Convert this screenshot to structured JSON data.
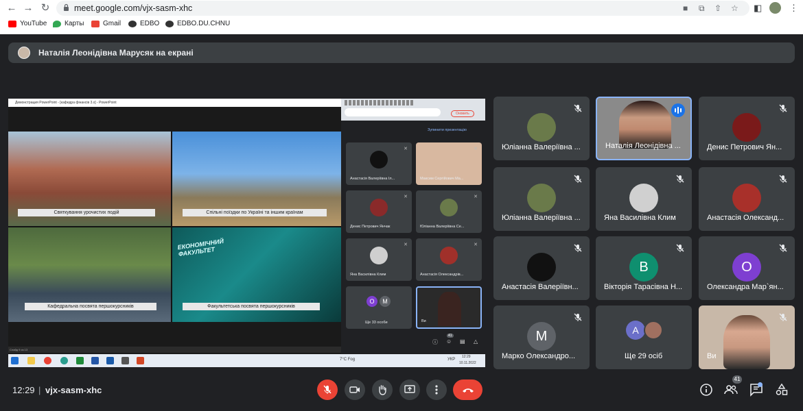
{
  "browser": {
    "url": "meet.google.com/vjx-sasm-xhc",
    "bookmarks": [
      "YouTube",
      "Карты",
      "Gmail",
      "EDBO",
      "EDBO.DU.CHNU"
    ]
  },
  "banner": {
    "text": "Наталія Леонідівна Марусяк на екрані"
  },
  "shared_screen": {
    "ppt_title": "Демонстрация PowerPoint - [кафедра фінансів 3.x] - PowerPoint",
    "captions": [
      "Святкування урочистих подій",
      "Спільні поїздки по Україні та іншим країнам",
      "Кафедральна посвята першокурсників",
      "Факультетська посвята першокурсників"
    ],
    "slide_heading": "ЕКОНОМІЧНИЙ ФАКУЛЬТЕТ",
    "status": "Слайд 9 из 13",
    "mini_button": "Оновить",
    "mini_link": "Зупинити презентацію",
    "mini_tiles": [
      {
        "name": "Анастасія Валеріївна Іл..."
      },
      {
        "name": "Максим Сергійович Ма..."
      },
      {
        "name": "Денис Петрович Янчак"
      },
      {
        "name": "Юліанна Валеріївна Се..."
      },
      {
        "name": "Яна Василівна Клим"
      },
      {
        "name": "Анастасія Олександрів..."
      },
      {
        "name": "Ще 33 особи",
        "letters": [
          "O",
          "M"
        ]
      },
      {
        "name": "Ви"
      }
    ],
    "mini_badge": "41",
    "taskbar": {
      "weather": "7°C Fog",
      "lang": "УКР",
      "time": "12:29",
      "date": "10.11.2022"
    }
  },
  "tiles": [
    {
      "name": "Юліанна Валеріївна ..."
    },
    {
      "name": "Наталія Леонідівна ..."
    },
    {
      "name": "Денис Петрович Ян..."
    },
    {
      "name": "Юліанна Валеріївна ..."
    },
    {
      "name": "Яна Василівна Клим"
    },
    {
      "name": "Анастасія Олександ..."
    },
    {
      "name": "Анастасія Валеріївн..."
    },
    {
      "name": "Вікторія Тарасівна Н...",
      "letter": "B"
    },
    {
      "name": "Олександра Мар`ян...",
      "letter": "O"
    },
    {
      "name": "Марко Олександро...",
      "letter": "M"
    },
    {
      "name": "Ще 29 осіб",
      "letter": "A"
    },
    {
      "name": "Ви"
    }
  ],
  "colors": {
    "tile_bg": "#3c4043",
    "page_bg": "#202124",
    "letter_b": "#0f8f6f",
    "letter_o": "#7e3fd1",
    "letter_m": "#5f6368",
    "letter_a": "#6b6fc9",
    "active_border": "#8ab4f8",
    "danger": "#ea4335"
  },
  "bottom": {
    "time": "12:29",
    "separator": "|",
    "code": "vjx-sasm-xhc",
    "people_badge": "41"
  }
}
